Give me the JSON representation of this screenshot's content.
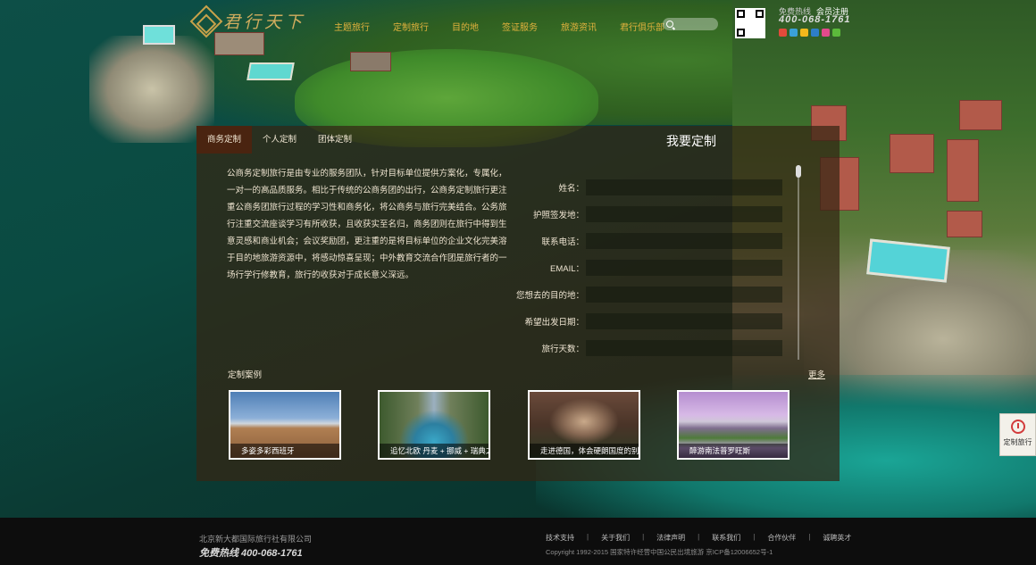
{
  "header": {
    "logo_text": "君行天下",
    "nav": [
      "主题旅行",
      "定制旅行",
      "目的地",
      "签证服务",
      "旅游资讯",
      "君行俱乐部"
    ],
    "search_placeholder": "",
    "hotline_label": "免费热线",
    "register_label": "会员注册",
    "hotline_number": "400-068-1761",
    "social_icons": [
      "weibo-icon",
      "tencent-weibo-icon",
      "qzone-icon",
      "renren-icon",
      "douban-icon",
      "wechat-icon"
    ]
  },
  "tabs": [
    {
      "label": "商务定制",
      "active": true
    },
    {
      "label": "个人定制",
      "active": false
    },
    {
      "label": "团体定制",
      "active": false
    }
  ],
  "intro_text": "公商务定制旅行是由专业的服务团队，针对目标单位提供方案化，专属化，一对一的高品质服务。相比于传统的公商务团的出行，公商务定制旅行更注重公商务团旅行过程的学习性和商务化，将公商务与旅行完美结合。公务旅行注重交流座谈学习有所收获，且收获实至名归，商务团则在旅行中得到生意灵感和商业机会；会议奖励团，更注重的是将目标单位的企业文化完美溶于目的地旅游资源中，将感动惊喜呈现；中外教育交流合作团是旅行者的一场行学行修教育，旅行的收获对于成长意义深远。",
  "form": {
    "title": "我要定制",
    "fields": [
      {
        "label": "姓名：",
        "value": ""
      },
      {
        "label": "护照签发地：",
        "value": ""
      },
      {
        "label": "联系电话：",
        "value": ""
      },
      {
        "label": "EMAIL：",
        "value": ""
      },
      {
        "label": "您想去的目的地：",
        "value": ""
      },
      {
        "label": "希望出发日期：",
        "value": ""
      },
      {
        "label": "旅行天数：",
        "value": ""
      }
    ]
  },
  "cases": {
    "title": "定制案例",
    "more_label": "更多",
    "items": [
      {
        "caption": "多姿多彩西班牙"
      },
      {
        "caption": "追忆北欧 丹麦 + 挪威 + 瑞典之"
      },
      {
        "caption": "走进德国，体会硬朗国度的别样"
      },
      {
        "caption": "醉游南法普罗旺斯"
      }
    ]
  },
  "side_widget": {
    "label": "定制旅行"
  },
  "footer": {
    "company": "北京新大都国际旅行社有限公司",
    "hotline": "免费热线 400-068-1761",
    "links": [
      "技术支持",
      "关于我们",
      "法律声明",
      "联系我们",
      "合作伙伴",
      "诚聘英才"
    ],
    "copyright": "Copyright 1992-2015 国家特许经营中国公民出境旅游 京ICP备12006652号-1"
  },
  "colors": {
    "nav_gold": "#e2b23d",
    "panel": "#34261480",
    "active_tab": "#4a2410"
  }
}
